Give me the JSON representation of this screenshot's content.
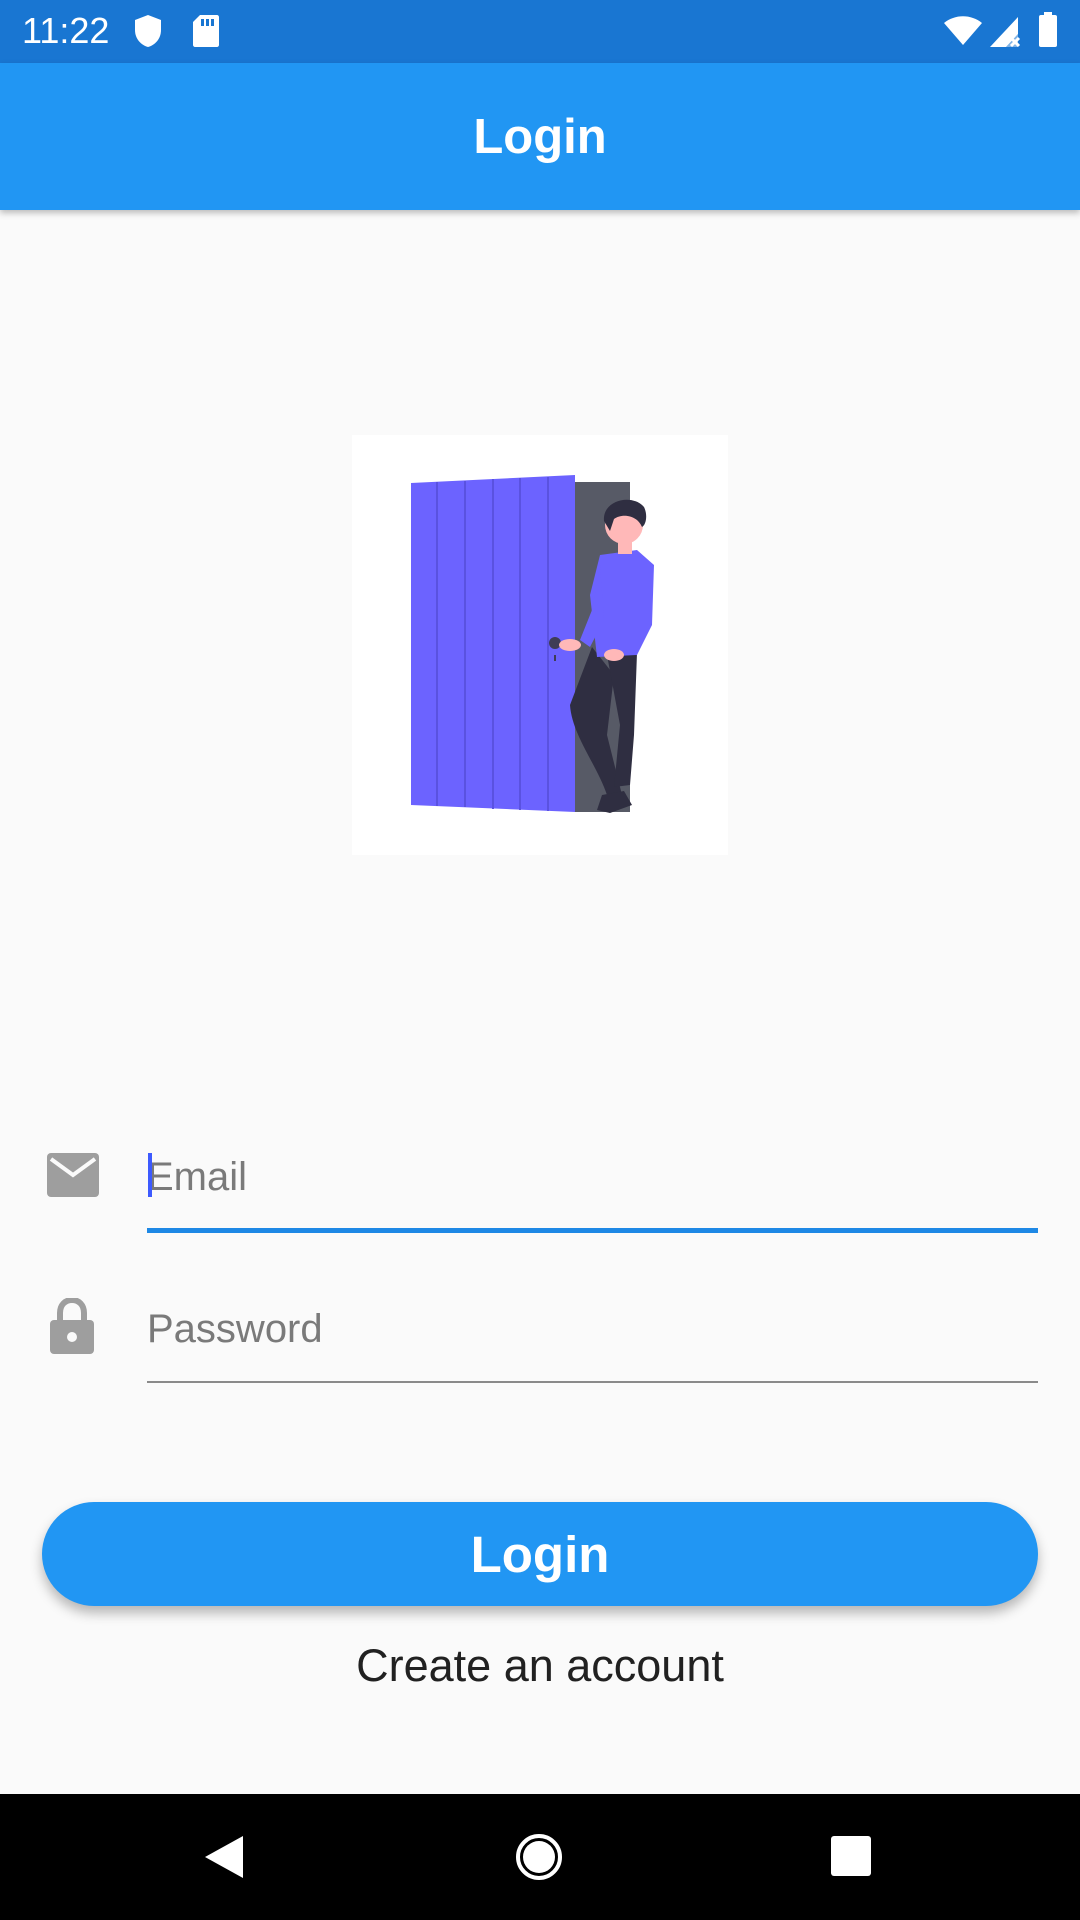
{
  "status_bar": {
    "time": "11:22",
    "icons": [
      "shield-icon",
      "sd-card-icon",
      "wifi-icon",
      "cell-signal-icon",
      "battery-icon"
    ]
  },
  "app_bar": {
    "title": "Login",
    "color": "#2196f3"
  },
  "illustration": {
    "icon": "person-at-door-illustration"
  },
  "form": {
    "email_placeholder": "Email",
    "email_value": "",
    "password_placeholder": "Password",
    "password_value": ""
  },
  "actions": {
    "login_label": "Login",
    "create_account_label": "Create an account"
  },
  "nav_bar": {
    "icons": [
      "back-icon",
      "home-icon",
      "recents-icon"
    ]
  },
  "colors": {
    "primary": "#2196f3",
    "status_bar": "#1976d2",
    "accent_line": "#1e88e5",
    "illustration_accent": "#6c63ff"
  }
}
